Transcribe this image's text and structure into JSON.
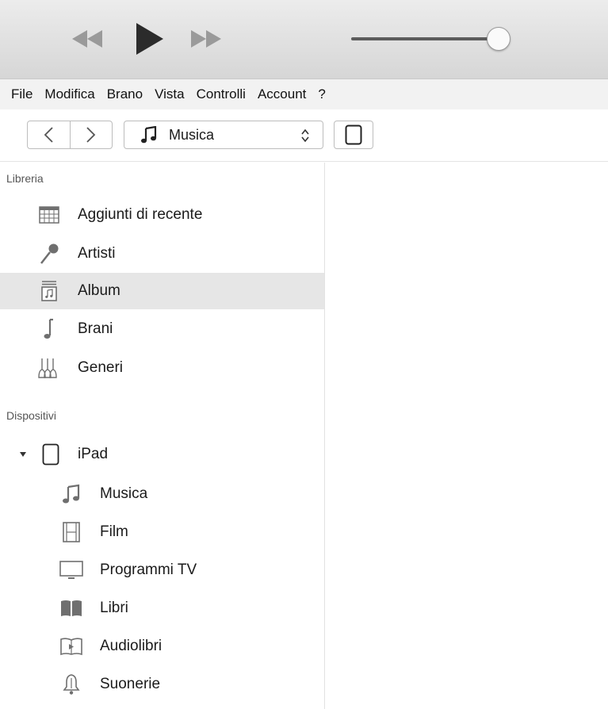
{
  "player": {
    "rewind_icon": "rewind-icon",
    "play_icon": "play-icon",
    "forward_icon": "fast-forward-icon",
    "volume_level": 0.88
  },
  "menu": [
    "File",
    "Modifica",
    "Brano",
    "Vista",
    "Controlli",
    "Account",
    "?"
  ],
  "navbar": {
    "library_selector": "Musica",
    "library_icon": "music-note-icon",
    "device_icon": "ipad-icon"
  },
  "sidebar": {
    "library_title": "Libreria",
    "library_items": [
      {
        "label": "Aggiunti di recente",
        "icon": "grid-calendar-icon"
      },
      {
        "label": "Artisti",
        "icon": "microphone-icon"
      },
      {
        "label": "Album",
        "icon": "album-icon",
        "selected": true
      },
      {
        "label": "Brani",
        "icon": "single-note-icon"
      },
      {
        "label": "Generi",
        "icon": "guitars-icon"
      }
    ],
    "devices_title": "Dispositivi",
    "device": {
      "label": "iPad",
      "icon": "ipad-icon",
      "expanded": true
    },
    "device_items": [
      {
        "label": "Musica",
        "icon": "music-note-icon"
      },
      {
        "label": "Film",
        "icon": "film-icon"
      },
      {
        "label": "Programmi TV",
        "icon": "tv-icon"
      },
      {
        "label": "Libri",
        "icon": "book-icon"
      },
      {
        "label": "Audiolibri",
        "icon": "audiobook-icon"
      },
      {
        "label": "Suonerie",
        "icon": "bell-icon"
      }
    ]
  },
  "colors": {
    "selected_row": "#e6e6e6",
    "icon_gray": "#6f6f6f",
    "transport_disabled": "#9a9a9a",
    "transport_active": "#2b2b2b"
  }
}
